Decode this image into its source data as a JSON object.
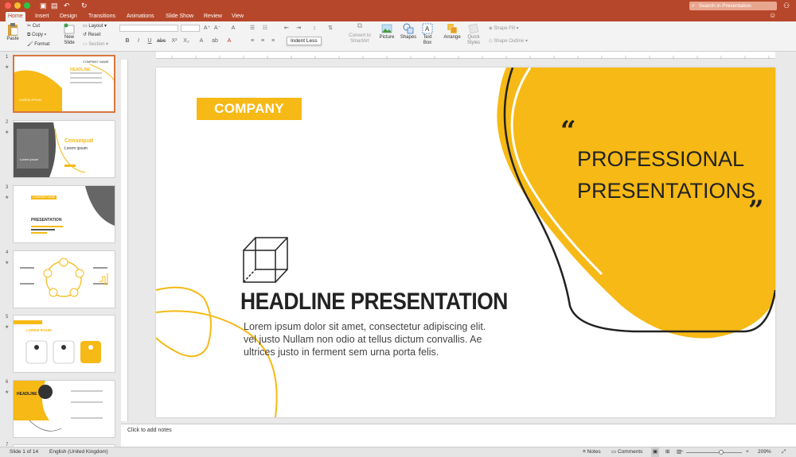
{
  "window": {
    "search_placeholder": "Search in Presentation"
  },
  "tabs": [
    {
      "label": "Home",
      "active": true
    },
    {
      "label": "Insert"
    },
    {
      "label": "Design"
    },
    {
      "label": "Transitions"
    },
    {
      "label": "Animations"
    },
    {
      "label": "Slide Show"
    },
    {
      "label": "Review"
    },
    {
      "label": "View"
    }
  ],
  "ribbon": {
    "paste": "Paste",
    "cut": "Cut",
    "copy": "Copy",
    "format": "Format",
    "new_slide_1": "New",
    "new_slide_2": "Slide",
    "layout": "Layout",
    "reset": "Reset",
    "section": "Section",
    "indent_tooltip": "Indent Less",
    "convert_1": "Convert to",
    "convert_2": "SmartArt",
    "picture": "Picture",
    "shapes": "Shapes",
    "textbox_1": "Text",
    "textbox_2": "Box",
    "arrange": "Arrange",
    "quick_1": "Quick",
    "quick_2": "Styles",
    "shape_fill": "Shape Fill",
    "shape_outline": "Shape Outline"
  },
  "thumbnails": [
    {
      "num": "1",
      "title": "HEADLINE",
      "sub": "COMPANY NAME",
      "label": "LOREM IPSUM"
    },
    {
      "num": "2",
      "title": "Consequat",
      "sub": "Lorem ipsum",
      "label": "Lorem ipsum"
    },
    {
      "num": "3",
      "title": "PRESENTATION",
      "sub": "COMPANY NAME"
    },
    {
      "num": "4"
    },
    {
      "num": "5",
      "title": "LOREM IPSUM"
    },
    {
      "num": "6",
      "title": "HEADLINE"
    },
    {
      "num": "7"
    }
  ],
  "slide": {
    "company": "COMPANY",
    "quote_line1": "PROFESSIONAL",
    "quote_line2": "PRESENTATIONS",
    "open_quote": "“",
    "close_quote": "”",
    "headline": "HEADLINE PRESENTATION",
    "body_line1": "Lorem ipsum dolor sit amet, consectetur adipiscing elit.",
    "body_line2": "vel justo Nullam non odio at tellus dictum convallis. Ae",
    "body_line3": "ultrices justo in ferment sem urna porta felis."
  },
  "notes_placeholder": "Click to add notes",
  "status": {
    "slide_info": "Slide 1 of 14",
    "language": "English (United Kingdom)",
    "notes": "Notes",
    "comments": "Comments",
    "zoom": "209%",
    "zoom_level": 0.63
  },
  "colors": {
    "accent": "#b7472a",
    "brand_yellow": "#f6b915"
  }
}
